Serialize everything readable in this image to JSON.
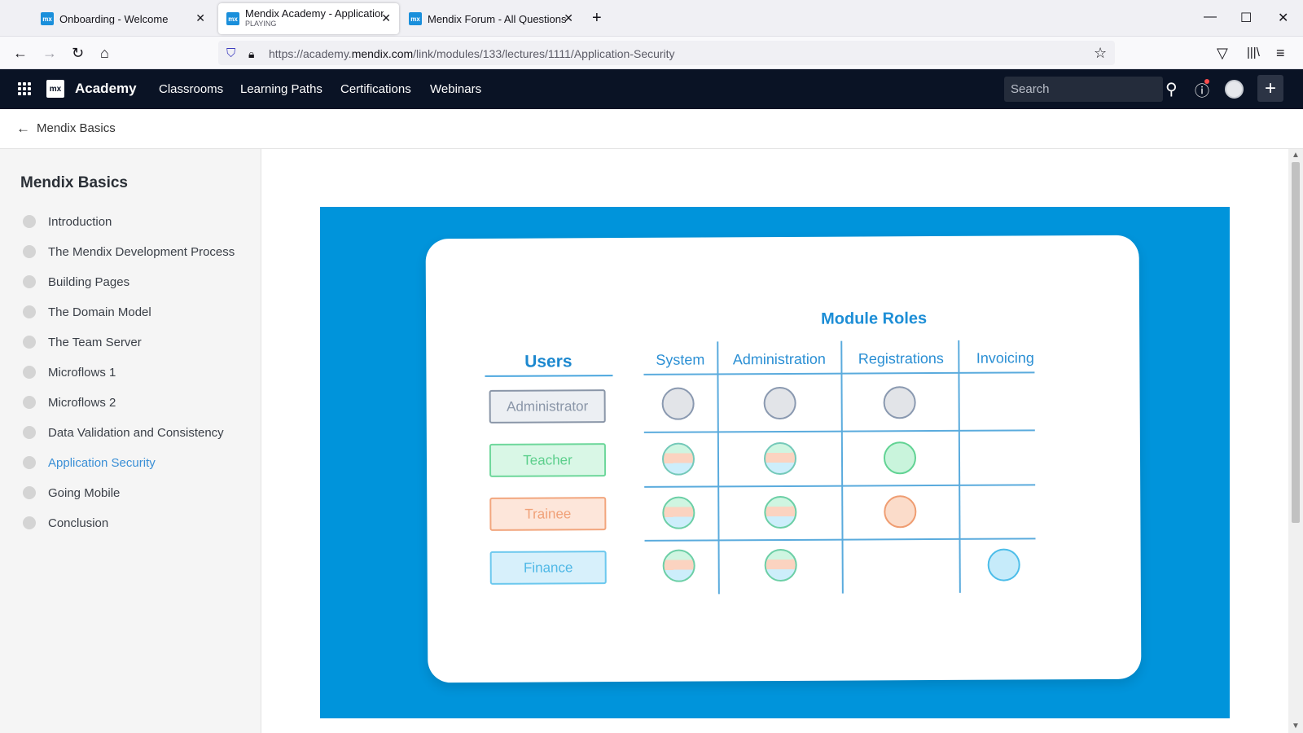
{
  "browser": {
    "tabs": [
      {
        "title": "Onboarding - Welcome",
        "subtitle": ""
      },
      {
        "title": "Mendix Academy - Application",
        "subtitle": "PLAYING"
      },
      {
        "title": "Mendix Forum - All Questions",
        "subtitle": ""
      }
    ],
    "favicon_label": "mx",
    "url_prefix": "https://academy.",
    "url_domain": "mendix.com",
    "url_path": "/link/modules/133/lectures/1111/Application-Security"
  },
  "header": {
    "logo_text": "mx",
    "brand": "Academy",
    "nav": [
      "Classrooms",
      "Learning Paths",
      "Certifications",
      "Webinars"
    ],
    "search_placeholder": "Search",
    "accent_color": "#0094db",
    "header_bg": "#0a1325"
  },
  "breadcrumb": {
    "label": "Mendix Basics"
  },
  "sidebar": {
    "title": "Mendix Basics",
    "lessons": [
      "Introduction",
      "The Mendix Development Process",
      "Building Pages",
      "The Domain Model",
      "The Team Server",
      "Microflows 1",
      "Microflows 2",
      "Data Validation and Consistency",
      "Application Security",
      "Going Mobile",
      "Conclusion"
    ],
    "current_lesson": "Application Security"
  },
  "slide": {
    "module_roles_title": "Module Roles",
    "users_title": "Users",
    "modules": [
      "System",
      "Administration",
      "Registrations",
      "Invoicing"
    ],
    "roles": [
      "Administrator",
      "Teacher",
      "Trainee",
      "Finance"
    ],
    "matrix": [
      [
        "gray",
        "gray",
        "gray",
        ""
      ],
      [
        "mix",
        "mix",
        "green",
        ""
      ],
      [
        "mix",
        "mix",
        "peach",
        ""
      ],
      [
        "mix",
        "mix",
        "",
        "blue"
      ]
    ]
  }
}
